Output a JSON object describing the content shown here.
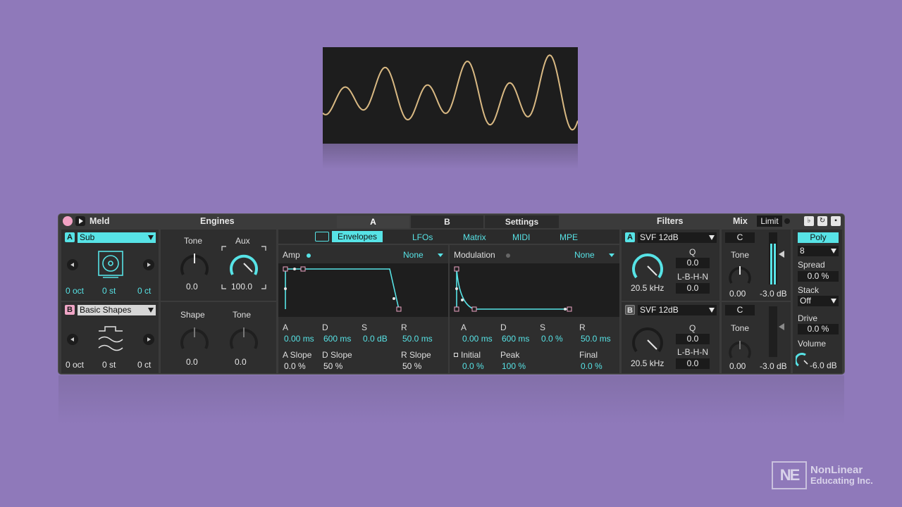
{
  "device": {
    "name": "Meld",
    "engines_label": "Engines",
    "tabs": [
      "A",
      "B",
      "Settings"
    ],
    "filters_label": "Filters",
    "mix_label": "Mix",
    "limit_label": "Limit"
  },
  "osc_a": {
    "badge": "A",
    "engine": "Sub",
    "octave": "0 oct",
    "semi": "0 st",
    "cents": "0 ct",
    "knob1_label": "Tone",
    "knob1_value": "0.0",
    "knob2_label": "Aux",
    "knob2_value": "100.0"
  },
  "osc_b": {
    "badge": "B",
    "engine": "Basic Shapes",
    "octave": "0 oct",
    "semi": "0 st",
    "cents": "0 ct",
    "knob1_label": "Shape",
    "knob1_value": "0.0",
    "knob2_label": "Tone",
    "knob2_value": "0.0"
  },
  "env_tabs": [
    "Envelopes",
    "LFOs",
    "Matrix",
    "MIDI",
    "MPE"
  ],
  "amp_env": {
    "title": "Amp",
    "target": "None",
    "labels": [
      "A",
      "D",
      "S",
      "R"
    ],
    "values": [
      "0.00 ms",
      "600 ms",
      "0.0 dB",
      "50.0 ms"
    ],
    "slope_labels": [
      "A Slope",
      "D Slope",
      "R Slope"
    ],
    "slope_values": [
      "0.0 %",
      "50 %",
      "50 %"
    ]
  },
  "mod_env": {
    "title": "Modulation",
    "target": "None",
    "labels": [
      "A",
      "D",
      "S",
      "R"
    ],
    "values": [
      "0.00 ms",
      "600 ms",
      "0.0 %",
      "50.0 ms"
    ],
    "extra_labels": [
      "Initial",
      "Peak",
      "Final"
    ],
    "extra_values": [
      "0.0 %",
      "100 %",
      "0.0 %"
    ]
  },
  "filter_a": {
    "badge": "A",
    "type": "SVF 12dB",
    "freq": "20.5 kHz",
    "q_label": "Q",
    "q_value": "0.0",
    "lbhn_label": "L-B-H-N",
    "lbhn_value": "0.0"
  },
  "filter_b": {
    "badge": "B",
    "type": "SVF 12dB",
    "freq": "20.5 kHz",
    "q_label": "Q",
    "q_value": "0.0",
    "lbhn_label": "L-B-H-N",
    "lbhn_value": "0.0"
  },
  "mix_a": {
    "c_label": "C",
    "tone_label": "Tone",
    "tone_value": "0.00",
    "level": "-3.0 dB"
  },
  "mix_b": {
    "c_label": "C",
    "tone_label": "Tone",
    "tone_value": "0.00",
    "level": "-3.0 dB"
  },
  "global": {
    "poly": "Poly",
    "voices": "8",
    "spread_label": "Spread",
    "spread_value": "0.0 %",
    "stack_label": "Stack",
    "stack_value": "Off",
    "drive_label": "Drive",
    "drive_value": "0.0 %",
    "volume_label": "Volume",
    "volume_value": "-6.0 dB"
  },
  "watermark": {
    "line1": "NonLinear",
    "line2": "Educating Inc."
  },
  "colors": {
    "background": "#8f79ba",
    "accent": "#57e3e6",
    "scope_wave": "#d9b983",
    "envelope_node": "#f0a6c6"
  }
}
